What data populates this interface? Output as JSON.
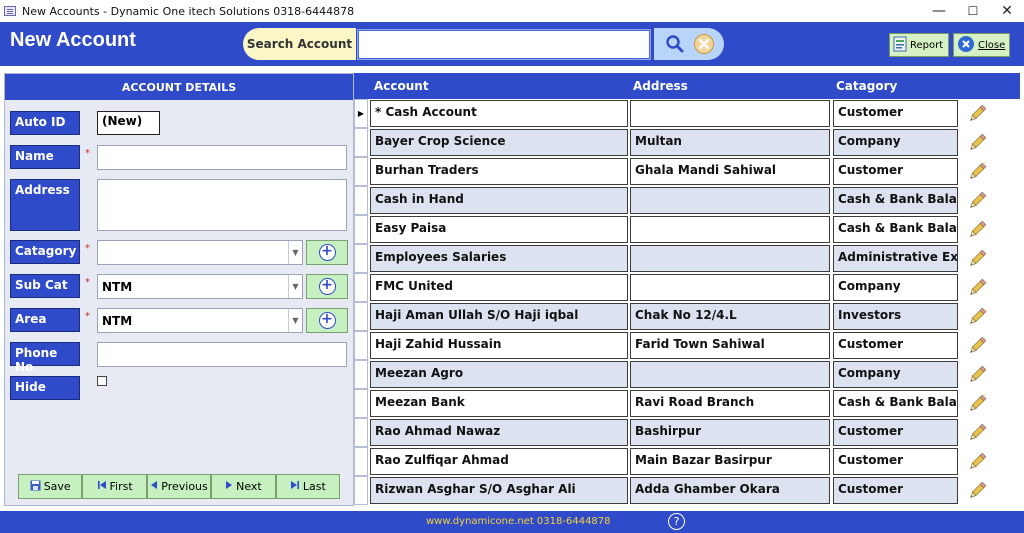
{
  "window": {
    "title": "New Accounts - Dynamic One itech Solutions 0318-6444878",
    "minimize": "—",
    "maximize": "☐",
    "close": "✕"
  },
  "header": {
    "title": "New Account",
    "search_label": "Search Account",
    "search_value": "",
    "report_label": "Report",
    "close_label": "Close"
  },
  "form": {
    "panel_title": "ACCOUNT DETAILS",
    "fields": {
      "auto_id": {
        "label": "Auto ID",
        "value": "(New)"
      },
      "name": {
        "label": "Name",
        "value": ""
      },
      "address": {
        "label": "Address",
        "value": ""
      },
      "category": {
        "label": "Catagory",
        "value": ""
      },
      "sub_cat": {
        "label": "Sub Cat",
        "value": "NTM"
      },
      "area": {
        "label": "Area",
        "value": "NTM"
      },
      "phone": {
        "label": "Phone No",
        "value": ""
      },
      "hide": {
        "label": "Hide",
        "checked": false
      }
    },
    "required_mark": "*",
    "nav": {
      "save": "Save",
      "first": "First",
      "previous": "Previous",
      "next": "Next",
      "last": "Last"
    }
  },
  "grid": {
    "columns": [
      "Account",
      "Address",
      "Catagory"
    ],
    "rows": [
      {
        "account": "*  Cash Account",
        "address": "",
        "category": "Customer"
      },
      {
        "account": "Bayer Crop Science",
        "address": "Multan",
        "category": "Company"
      },
      {
        "account": "Burhan Traders",
        "address": "Ghala Mandi Sahiwal",
        "category": "Customer"
      },
      {
        "account": "Cash in Hand",
        "address": "",
        "category": "Cash & Bank Balance"
      },
      {
        "account": "Easy Paisa",
        "address": "",
        "category": "Cash & Bank Balance"
      },
      {
        "account": "Employees Salaries",
        "address": "",
        "category": "Administrative Expe"
      },
      {
        "account": "FMC United",
        "address": "",
        "category": "Company"
      },
      {
        "account": "Haji Aman Ullah S/O Haji iqbal",
        "address": "Chak No 12/4.L",
        "category": "Investors"
      },
      {
        "account": "Haji Zahid Hussain",
        "address": "Farid Town Sahiwal",
        "category": "Customer"
      },
      {
        "account": "Meezan Agro",
        "address": "",
        "category": "Company"
      },
      {
        "account": "Meezan Bank",
        "address": "Ravi Road Branch",
        "category": "Cash & Bank Balance"
      },
      {
        "account": "Rao Ahmad Nawaz",
        "address": "Bashirpur",
        "category": "Customer"
      },
      {
        "account": "Rao Zulfiqar Ahmad",
        "address": "Main Bazar Basirpur",
        "category": "Customer"
      },
      {
        "account": "Rizwan Asghar S/O Asghar Ali",
        "address": "Adda Ghamber Okara",
        "category": "Customer"
      }
    ]
  },
  "footer": {
    "website": "www.dynamicone.net 0318-6444878",
    "help": "?"
  },
  "colors": {
    "brand_blue": "#2f4bc9",
    "button_green": "#c6f0c0",
    "alt_row": "#dde2f0",
    "footer_text": "#f4d23a"
  },
  "icons": [
    "app-icon",
    "search-icon",
    "clear-icon",
    "report-icon",
    "close-icon",
    "add-icon",
    "dropdown-arrow-icon",
    "save-icon",
    "first-icon",
    "previous-icon",
    "next-icon",
    "last-icon",
    "edit-pencil-icon",
    "help-icon",
    "record-selector-icon"
  ]
}
